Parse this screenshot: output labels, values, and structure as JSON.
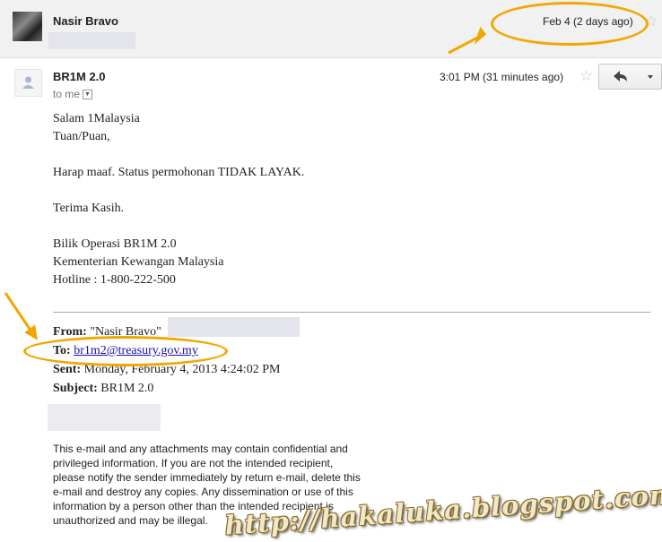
{
  "collapsed_message": {
    "sender_name": "Nasir Bravo",
    "date": "Feb 4 (2 days ago)"
  },
  "message": {
    "subject_sender": "BR1M 2.0",
    "recipient": "to me",
    "time": "3:01 PM (31 minutes ago)",
    "body_lines": [
      "Salam 1Malaysia",
      "Tuan/Puan,",
      "Harap maaf.  Status permohonan TIDAK LAYAK.",
      "Terima Kasih.",
      "Bilik Operasi BR1M 2.0",
      "Kementerian Kewangan Malaysia",
      "Hotline : 1-800-222-500"
    ],
    "quoted": {
      "from_label": "From:",
      "from_value": "\"Nasir Bravo\"",
      "to_label": "To:",
      "to_value": "br1m2@treasury.gov.my",
      "sent_label": "Sent:",
      "sent_value": "Monday, February 4, 2013 4:24:02 PM",
      "subject_label": "Subject:",
      "subject_value": "BR1M 2.0"
    },
    "disclaimer_lines": [
      "This e-mail and any attachments may contain confidential and",
      "privileged information. If you are not the intended recipient,",
      "please notify the sender immediately by return e-mail, delete this",
      "e-mail and destroy any copies. Any dissemination or use of this",
      "information by a person other than the intended recipient is",
      "unauthorized and may be illegal."
    ]
  },
  "watermark": "http://hakaluka.blogspot.com",
  "icons": {
    "star": "star-outline-icon",
    "reply": "reply-arrow-icon",
    "more": "dropdown-triangle-icon"
  },
  "colors": {
    "highlight_oval": "#f2a600",
    "link": "#1a0dab"
  }
}
